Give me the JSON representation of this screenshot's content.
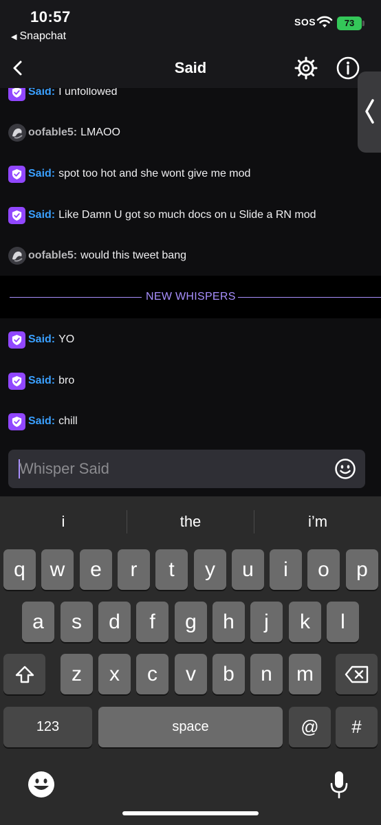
{
  "status_bar": {
    "time": "10:57",
    "back_app": "Snapchat",
    "sos": "SOS",
    "battery": "73"
  },
  "header": {
    "title": "Said"
  },
  "messages": [
    {
      "sender": "Said",
      "type": "verified",
      "text": "I unfollowed"
    },
    {
      "sender": "oofable5",
      "type": "avatar",
      "text": "LMAOO"
    },
    {
      "sender": "Said",
      "type": "verified",
      "text": "spot too hot and she wont give me mod"
    },
    {
      "sender": "Said",
      "type": "verified",
      "text": "Like Damn U got so much docs on u Slide a RN mod"
    },
    {
      "sender": "oofable5",
      "type": "avatar",
      "text": "would this tweet bang"
    }
  ],
  "divider": {
    "label": "NEW WHISPERS"
  },
  "new_messages": [
    {
      "sender": "Said",
      "type": "verified",
      "text": "YO"
    },
    {
      "sender": "Said",
      "type": "verified",
      "text": "bro"
    },
    {
      "sender": "Said",
      "type": "verified",
      "text": "chill"
    }
  ],
  "input": {
    "placeholder": "Whisper Said",
    "value": ""
  },
  "keyboard": {
    "suggestions": [
      "i",
      "the",
      "i’m"
    ],
    "row1": [
      "q",
      "w",
      "e",
      "r",
      "t",
      "y",
      "u",
      "i",
      "o",
      "p"
    ],
    "row2": [
      "a",
      "s",
      "d",
      "f",
      "g",
      "h",
      "j",
      "k",
      "l"
    ],
    "row3": [
      "z",
      "x",
      "c",
      "v",
      "b",
      "n",
      "m"
    ],
    "numbers_key": "123",
    "space_key": "space",
    "at_key": "@",
    "hash_key": "#"
  },
  "colors": {
    "accent": "#9147ff",
    "said_name": "#3aa0ff",
    "divider": "#a990ff",
    "background": "#0e0e10"
  }
}
